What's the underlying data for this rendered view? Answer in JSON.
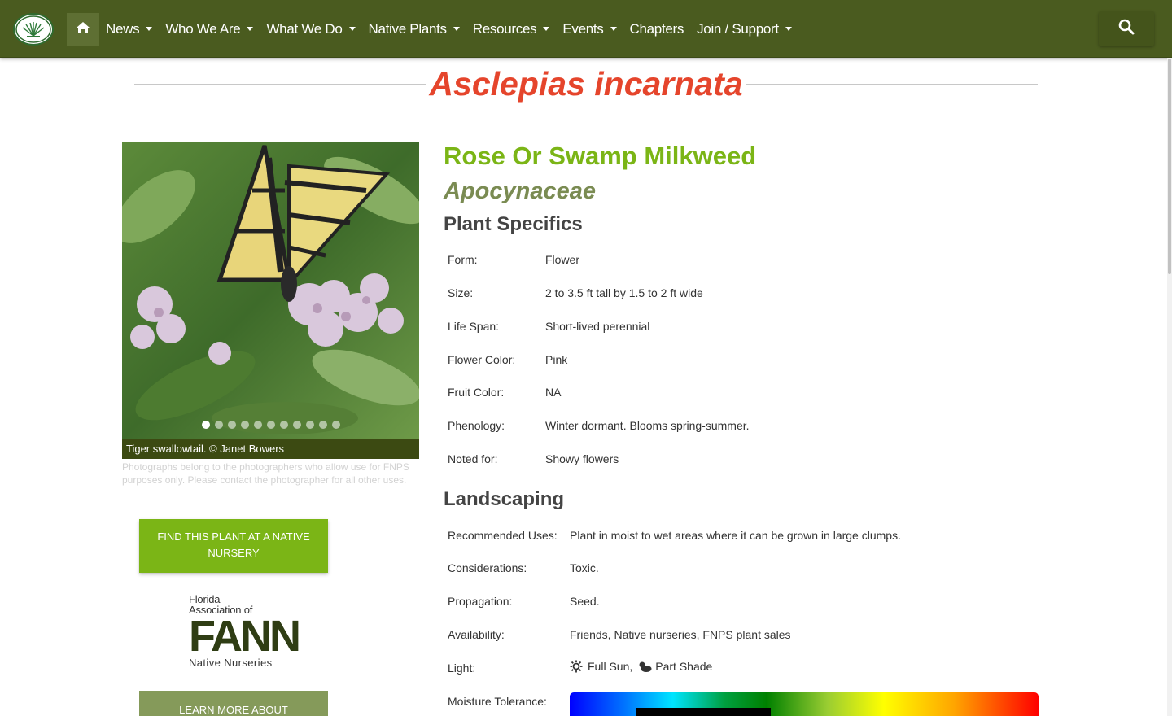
{
  "nav": {
    "items": [
      {
        "label": "News",
        "dropdown": true
      },
      {
        "label": "Who We Are",
        "dropdown": true
      },
      {
        "label": "What We Do",
        "dropdown": true
      },
      {
        "label": "Native Plants",
        "dropdown": true
      },
      {
        "label": "Resources",
        "dropdown": true
      },
      {
        "label": "Events",
        "dropdown": true
      },
      {
        "label": "Chapters",
        "dropdown": false
      },
      {
        "label": "Join / Support",
        "dropdown": true
      }
    ],
    "home_icon": "home-icon",
    "search_icon": "search-icon",
    "bar_color": "#4a5b1f"
  },
  "page": {
    "title": "Asclepias incarnata",
    "common_name": "Rose Or Swamp Milkweed",
    "family": "Apocynaceae"
  },
  "gallery": {
    "caption": "Tiger swallowtail.  © Janet Bowers",
    "slide_count": 11,
    "active_slide": 1,
    "disclaimer": "Photographs belong to the photographers who allow use for FNPS purposes only. Please contact the photographer for all other uses."
  },
  "buttons": {
    "find_plant": "Find this plant at a native nursery",
    "learn_more": "Learn more about"
  },
  "fann": {
    "line1": "Florida",
    "line2": "Association of",
    "big": "FANN",
    "line3": "Native Nurseries"
  },
  "specifics": {
    "heading": "Plant Specifics",
    "rows": [
      {
        "label": "Form:",
        "value": "Flower"
      },
      {
        "label": "Size:",
        "value": "2 to 3.5 ft tall by 1.5 to 2 ft wide"
      },
      {
        "label": "Life Span:",
        "value": "Short-lived perennial"
      },
      {
        "label": "Flower Color:",
        "value": "Pink"
      },
      {
        "label": "Fruit Color:",
        "value": "NA"
      },
      {
        "label": "Phenology:",
        "value": "Winter dormant. Blooms spring-summer."
      },
      {
        "label": "Noted for:",
        "value": "Showy flowers"
      }
    ]
  },
  "landscaping": {
    "heading": "Landscaping",
    "rows": [
      {
        "label": "Recommended Uses:",
        "value": "Plant in moist to wet areas where it can be grown in large clumps."
      },
      {
        "label": "Considerations:",
        "value": "Toxic."
      },
      {
        "label": "Propagation:",
        "value": "Seed."
      },
      {
        "label": "Availability:",
        "value": "Friends, Native nurseries, FNPS plant sales"
      },
      {
        "label": "Light:",
        "value": ""
      },
      {
        "label": "Moisture Tolerance:",
        "value": ""
      }
    ],
    "light": [
      {
        "icon": "sun-icon",
        "label": "Full Sun,"
      },
      {
        "icon": "part-shade-icon",
        "label": "Part Shade"
      }
    ]
  },
  "colors": {
    "title": "#e5452c",
    "common_name": "#7bb516",
    "family": "#7a8b52",
    "button_green": "#7bb516"
  }
}
